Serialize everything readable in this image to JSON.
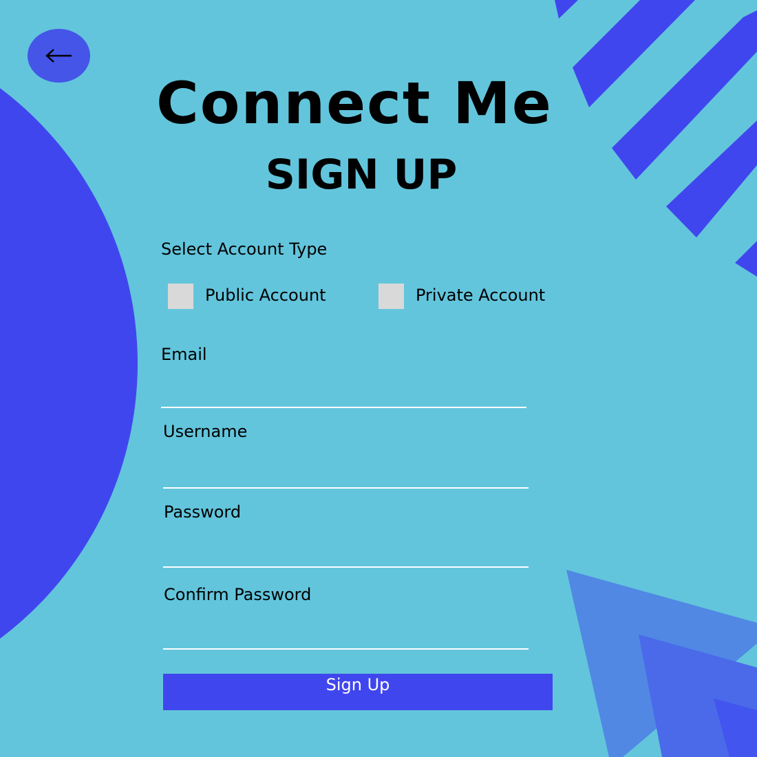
{
  "header": {
    "back_icon": "arrow-left-icon",
    "app_title": "Connect Me",
    "page_title": "SIGN UP"
  },
  "account_type": {
    "label": "Select Account Type",
    "options": [
      {
        "label": "Public Account",
        "checked": false
      },
      {
        "label": "Private Account",
        "checked": false
      }
    ]
  },
  "fields": {
    "email": {
      "label": "Email",
      "value": ""
    },
    "username": {
      "label": "Username",
      "value": ""
    },
    "password": {
      "label": "Password",
      "value": ""
    },
    "confirm_password": {
      "label": "Confirm Password",
      "value": ""
    }
  },
  "submit": {
    "label": "Sign Up"
  },
  "colors": {
    "background": "#62c5dc",
    "accent": "#4046ee",
    "checkbox": "#d9d9d9"
  }
}
